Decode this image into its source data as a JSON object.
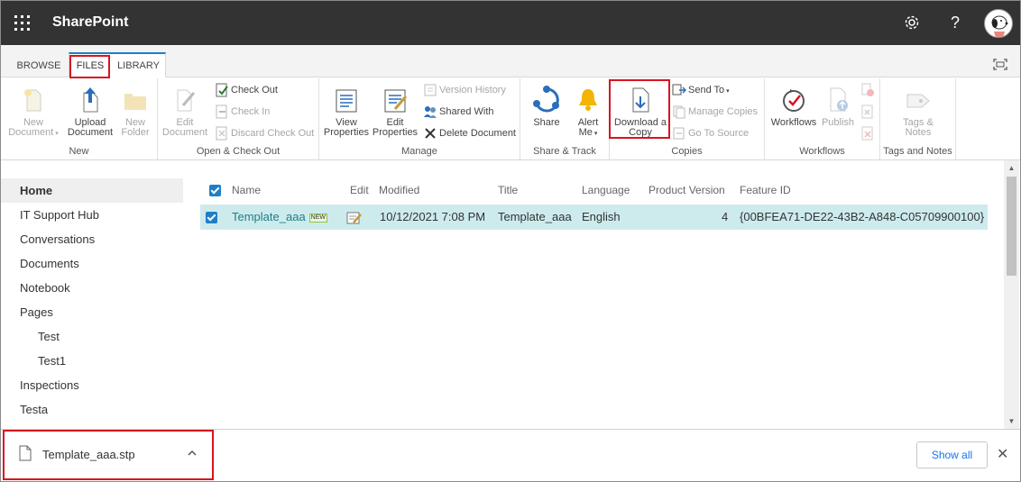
{
  "suitebar": {
    "brand": "SharePoint",
    "settings_icon": "gear-icon",
    "help_label": "?",
    "waffle_icon": "app-launcher-icon",
    "avatar_icon": "user-avatar"
  },
  "tabs": [
    {
      "label": "BROWSE",
      "active": false
    },
    {
      "label": "FILES",
      "active": true
    },
    {
      "label": "LIBRARY",
      "active": false
    }
  ],
  "ribbon": {
    "groups": {
      "new": "New",
      "open_checkout": "Open & Check Out",
      "manage": "Manage",
      "share_track": "Share & Track",
      "copies": "Copies",
      "workflows": "Workflows",
      "tags_notes": "Tags and Notes"
    },
    "new_document": [
      "New",
      "Document"
    ],
    "upload_document": [
      "Upload",
      "Document"
    ],
    "new_folder": [
      "New",
      "Folder"
    ],
    "edit_document": [
      "Edit",
      "Document"
    ],
    "check_out": "Check Out",
    "check_in": "Check In",
    "discard_check_out": "Discard Check Out",
    "view_properties": [
      "View",
      "Properties"
    ],
    "edit_properties": [
      "Edit",
      "Properties"
    ],
    "version_history": "Version History",
    "shared_with": "Shared With",
    "delete_document": "Delete Document",
    "share": "Share",
    "alert_me": [
      "Alert",
      "Me"
    ],
    "download_copy": [
      "Download a",
      "Copy"
    ],
    "send_to": "Send To",
    "manage_copies": "Manage Copies",
    "go_to_source": "Go To Source",
    "workflows": "Workflows",
    "publish": "Publish",
    "tags_notes": [
      "Tags &",
      "Notes"
    ]
  },
  "leftnav": [
    {
      "label": "Home",
      "active": true,
      "sub": false
    },
    {
      "label": "IT Support Hub",
      "active": false,
      "sub": false
    },
    {
      "label": "Conversations",
      "active": false,
      "sub": false
    },
    {
      "label": "Documents",
      "active": false,
      "sub": false
    },
    {
      "label": "Notebook",
      "active": false,
      "sub": false
    },
    {
      "label": "Pages",
      "active": false,
      "sub": false
    },
    {
      "label": "Test",
      "active": false,
      "sub": true
    },
    {
      "label": "Test1",
      "active": false,
      "sub": true
    },
    {
      "label": "Inspections",
      "active": false,
      "sub": false
    },
    {
      "label": "Testa",
      "active": false,
      "sub": false
    }
  ],
  "list": {
    "columns": [
      "Name",
      "Edit",
      "Modified",
      "Title",
      "Language",
      "Product Version",
      "Feature ID"
    ],
    "rows": [
      {
        "name": "Template_aaa",
        "new_badge": "NEW",
        "modified": "10/12/2021 7:08 PM",
        "title": "Template_aaa",
        "language": "English",
        "product_version": "4",
        "feature_id": "{00BFEA71-DE22-43B2-A848-C05709900100}",
        "selected": true
      }
    ]
  },
  "download_bar": {
    "filename": "Template_aaa.stp",
    "show_all": "Show all",
    "close": "✕"
  },
  "colors": {
    "suitebar": "#333333",
    "accent": "#1e7ec8",
    "selected_row": "#cdebed",
    "highlight_box": "#d8141f"
  }
}
